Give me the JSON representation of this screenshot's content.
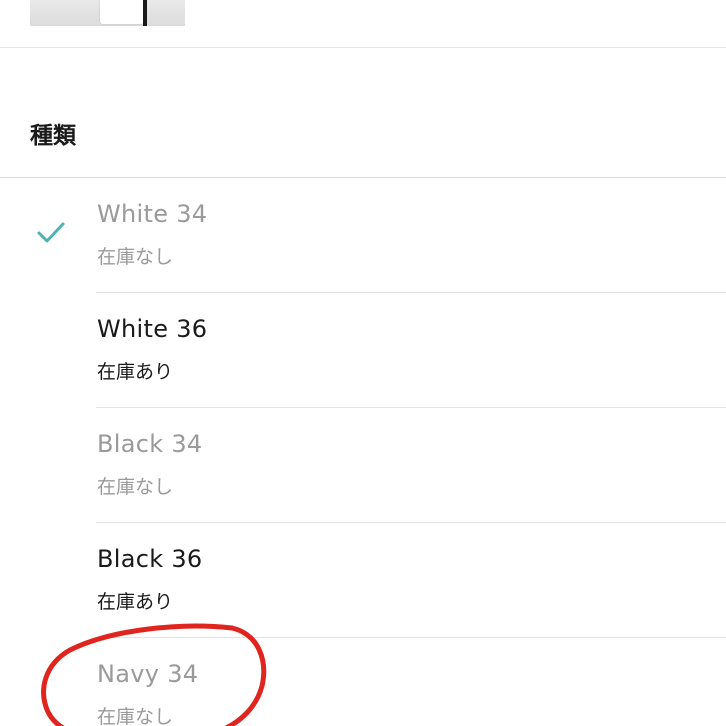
{
  "section": {
    "title": "種類"
  },
  "variants": [
    {
      "name": "White 34",
      "stock": "在庫なし",
      "selected": true,
      "available": false
    },
    {
      "name": "White 36",
      "stock": "在庫あり",
      "selected": false,
      "available": true
    },
    {
      "name": "Black 34",
      "stock": "在庫なし",
      "selected": false,
      "available": false
    },
    {
      "name": "Black 36",
      "stock": "在庫あり",
      "selected": false,
      "available": true
    },
    {
      "name": "Navy 34",
      "stock": "在庫なし",
      "selected": false,
      "available": false
    }
  ],
  "colors": {
    "check": "#4db3b0",
    "annotation_circle": "#e0251f",
    "text_primary": "#1a1a1a",
    "text_disabled": "#9a9a9a"
  },
  "icons": {
    "selected": "checkmark-icon"
  }
}
